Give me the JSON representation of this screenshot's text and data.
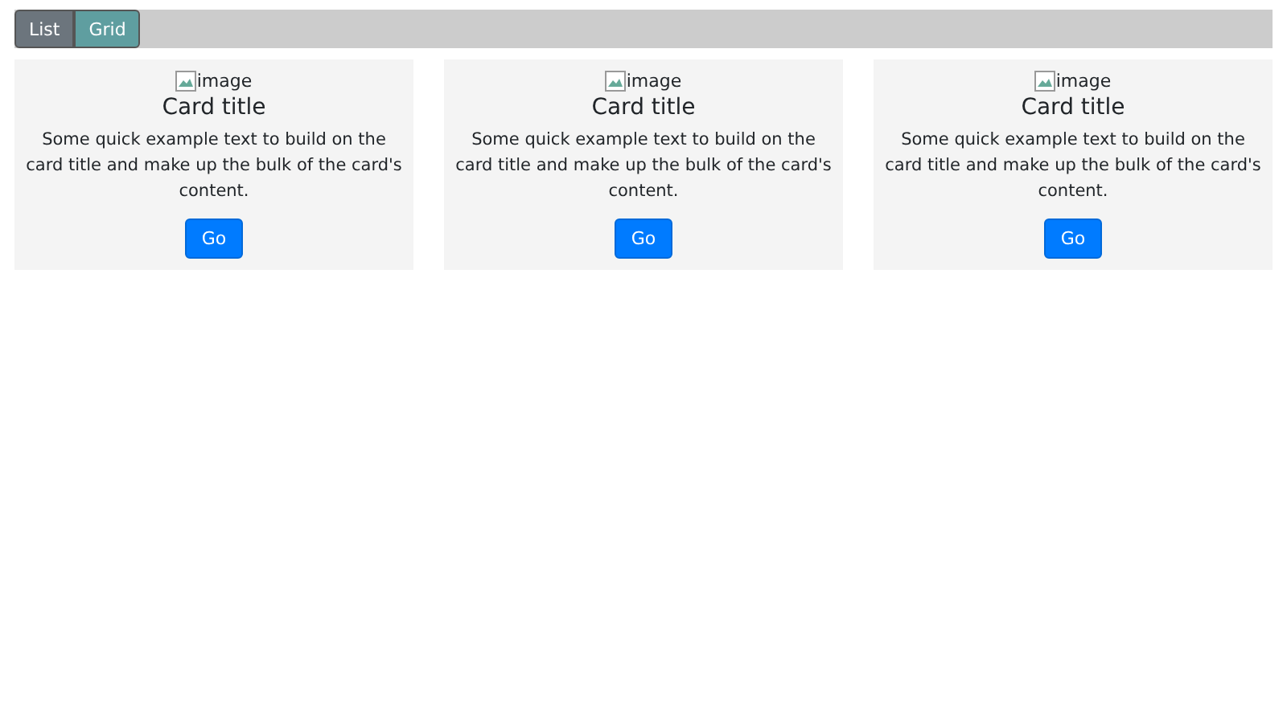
{
  "view_toggle": [
    {
      "label": "List",
      "selected": false
    },
    {
      "label": "Grid",
      "selected": true
    }
  ],
  "cards": [
    {
      "image_alt": "image",
      "title": "Card title",
      "text": "Some quick example text to build on the card title and make up the bulk of the card's content.",
      "button": "Go"
    },
    {
      "image_alt": "image",
      "title": "Card title",
      "text": "Some quick example text to build on the card title and make up the bulk of the card's content.",
      "button": "Go"
    },
    {
      "image_alt": "image",
      "title": "Card title",
      "text": "Some quick example text to build on the card title and make up the bulk of the card's content.",
      "button": "Go"
    }
  ]
}
